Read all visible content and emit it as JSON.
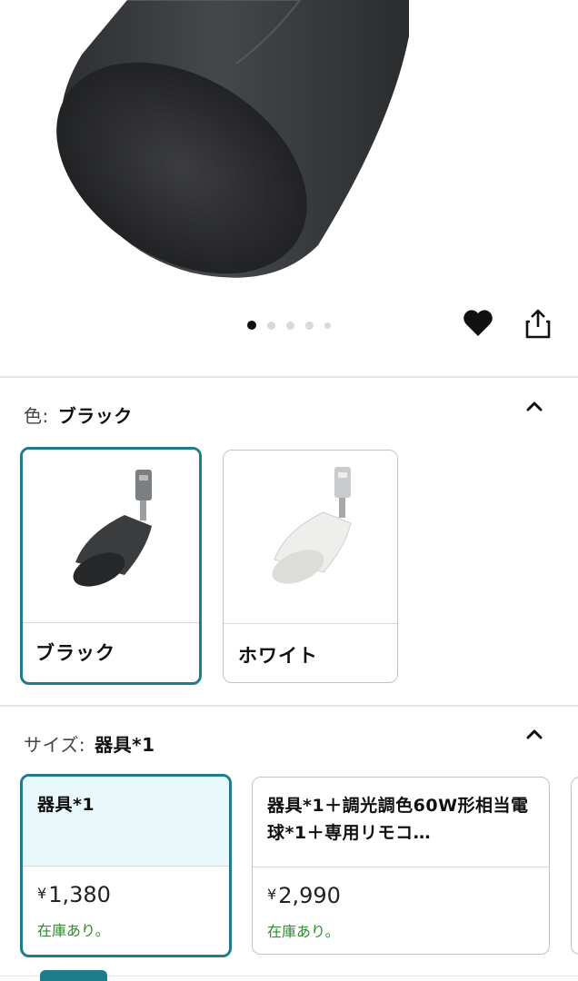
{
  "hero": {
    "image_alt": "ブラック スポットライト",
    "dots": [
      true,
      false,
      false,
      false,
      false
    ],
    "icons": {
      "favorite": "heart-icon",
      "share": "share-icon"
    }
  },
  "color_section": {
    "label": "色:",
    "value": "ブラック",
    "options": [
      {
        "label": "ブラック",
        "selected": true,
        "shade_color": "#3a3c3e"
      },
      {
        "label": "ホワイト",
        "selected": false,
        "shade_color": "#eeeeec"
      }
    ]
  },
  "size_section": {
    "label": "サイズ:",
    "value": "器具*1",
    "options": [
      {
        "name": "器具*1",
        "price_symbol": "¥",
        "price": "1,380",
        "stock": "在庫あり。",
        "selected": true
      },
      {
        "name": "器具*1＋調光調色60W形相当電球*1＋専用リモコ…",
        "price_symbol": "¥",
        "price": "2,990",
        "stock": "在庫あり。",
        "selected": false
      }
    ]
  },
  "colors": {
    "accent": "#1f7c8a",
    "stock_green": "#2e8b2e",
    "selected_bg": "#e9f9fb"
  }
}
